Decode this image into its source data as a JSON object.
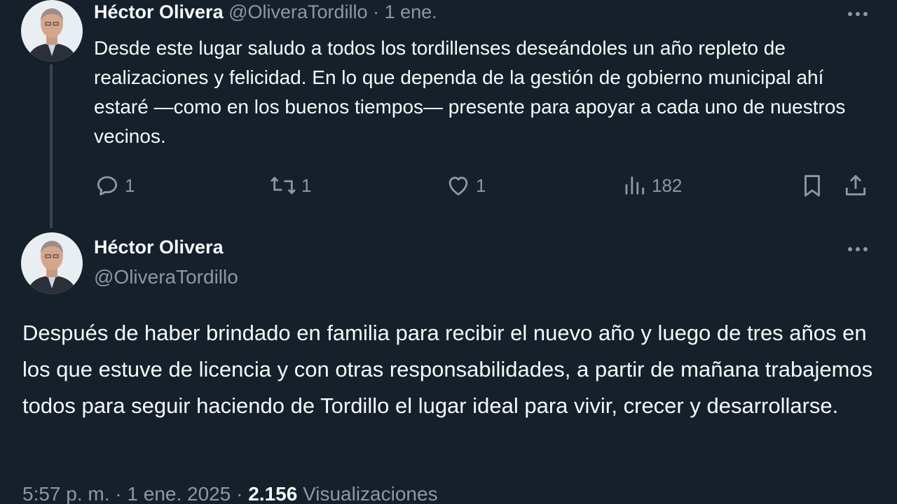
{
  "tweet1": {
    "display_name": "Héctor Olivera",
    "handle": "@OliveraTordillo",
    "separator": "·",
    "date": "1 ene.",
    "text": "Desde este lugar saludo a todos los tordillenses deseándoles un año repleto de realizaciones y felicidad. En lo que dependa de la gestión de gobierno municipal ahí estaré —como en los buenos tiempos— presente para apoyar a cada uno de nuestros vecinos.",
    "replies": "1",
    "reposts": "1",
    "likes": "1",
    "views": "182"
  },
  "tweet2": {
    "display_name": "Héctor Olivera",
    "handle": "@OliveraTordillo",
    "text": "Después de haber brindado en familia para recibir el nuevo año y luego de tres años en los que estuve de licencia y con otras responsabilidades, a partir de mañana trabajemos todos para seguir haciendo de Tordillo el lugar ideal para vivir, crecer y desarrollarse.",
    "time": "5:57 p. m.",
    "date": "1 ene. 2025",
    "views_count": "2.156",
    "views_label": "Visualizaciones"
  },
  "icons": {
    "reply": "reply-icon",
    "repost": "repost-icon",
    "like": "heart-icon",
    "views": "analytics-icon",
    "bookmark": "bookmark-icon",
    "share": "share-icon",
    "more": "more-icon"
  },
  "colors": {
    "background": "#15202b",
    "text": "#f7f9f9",
    "muted": "#8b98a5",
    "thread_line": "#38444d"
  }
}
